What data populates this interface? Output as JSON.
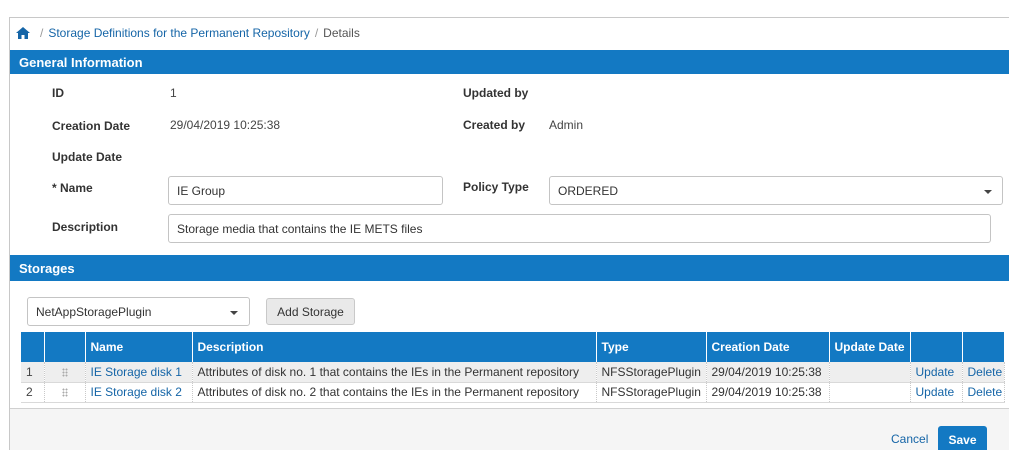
{
  "breadcrumb": {
    "home_icon": "home-icon",
    "parent": "Storage Definitions for the Permanent Repository",
    "current": "Details"
  },
  "general": {
    "title": "General Information",
    "id_label": "ID",
    "id_value": "1",
    "updated_by_label": "Updated by",
    "updated_by_value": "",
    "creation_date_label": "Creation Date",
    "creation_date_value": "29/04/2019 10:25:38",
    "created_by_label": "Created by",
    "created_by_value": "Admin",
    "update_date_label": "Update Date",
    "update_date_value": "",
    "name_label": "* Name",
    "name_value": "IE Group",
    "policy_type_label": "Policy Type",
    "policy_type_value": "ORDERED",
    "description_label": "Description",
    "description_value": "Storage media that contains the IE METS files"
  },
  "storages": {
    "title": "Storages",
    "plugin_select_value": "NetAppStoragePlugin",
    "add_button": "Add Storage",
    "columns": [
      "",
      "",
      "Name",
      "Description",
      "Type",
      "Creation Date",
      "Update Date",
      "",
      ""
    ],
    "rows": [
      {
        "num": "1",
        "name": "IE Storage disk 1",
        "description": "Attributes of disk no. 1 that contains the IEs in the Permanent repository",
        "type": "NFSStoragePlugin",
        "creation_date": "29/04/2019 10:25:38",
        "update_date": "",
        "update": "Update",
        "delete": "Delete"
      },
      {
        "num": "2",
        "name": "IE Storage disk 2",
        "description": "Attributes of disk no. 2 that contains the IEs in the Permanent repository",
        "type": "NFSStoragePlugin",
        "creation_date": "29/04/2019 10:25:38",
        "update_date": "",
        "update": "Update",
        "delete": "Delete"
      }
    ]
  },
  "footer": {
    "cancel": "Cancel",
    "save": "Save"
  },
  "colors": {
    "accent": "#1379c3",
    "link": "#1565a7"
  }
}
